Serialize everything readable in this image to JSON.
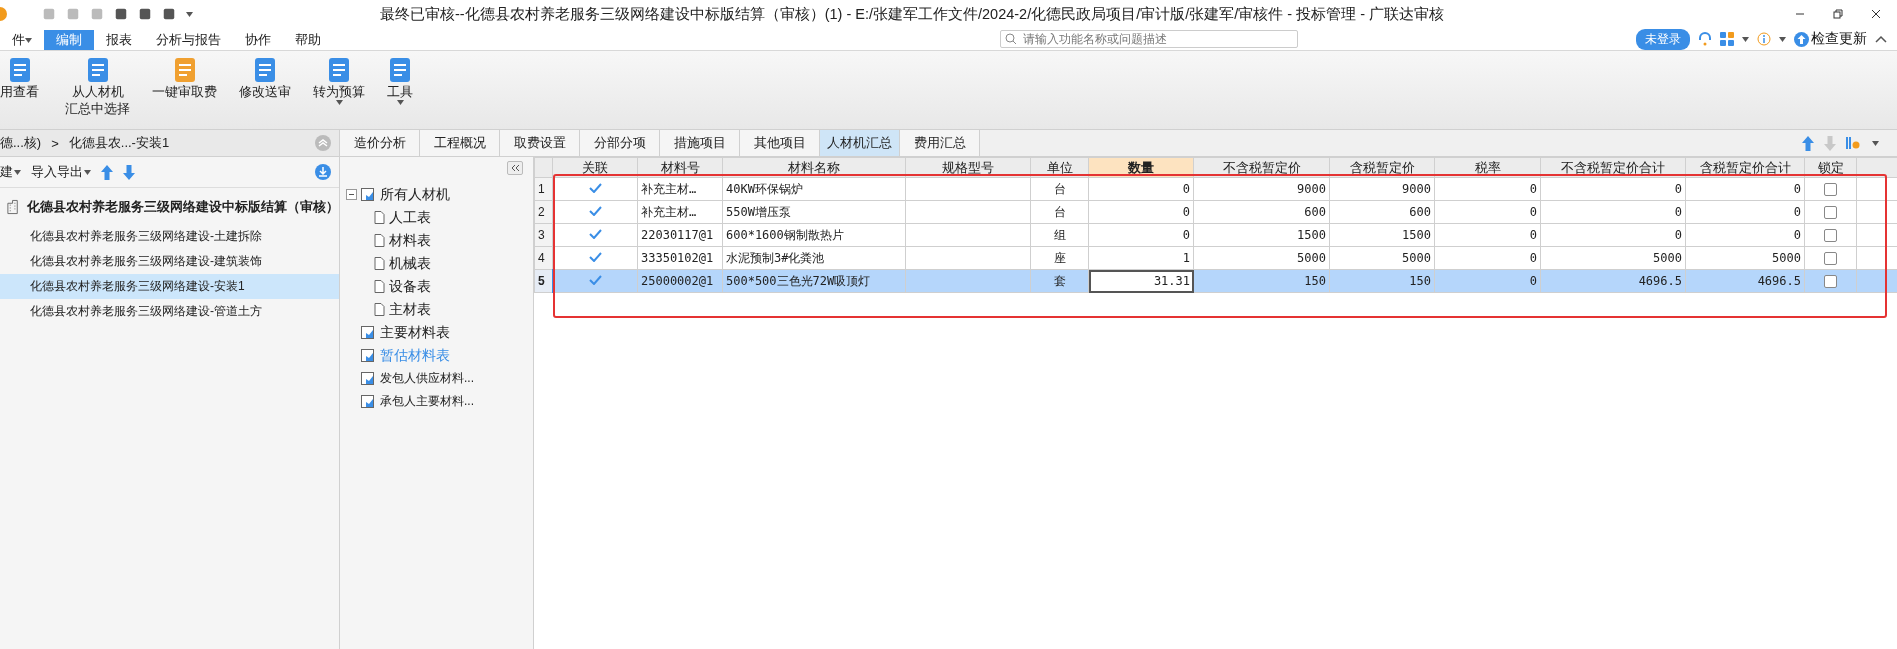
{
  "window": {
    "title": "最终已审核--化德县农村养老服务三级网络建设中标版结算（审核）(1) - E:/张建军工作文件/2024-2/化德民政局项目/审计版/张建军/审核件 - 投标管理 - 广联达审核"
  },
  "menu": [
    {
      "label": "件",
      "caret": true,
      "selected": false
    },
    {
      "label": "编制",
      "caret": false,
      "selected": true
    },
    {
      "label": "报表",
      "caret": false,
      "selected": false
    },
    {
      "label": "分析与报告",
      "caret": false,
      "selected": false
    },
    {
      "label": "协作",
      "caret": false,
      "selected": false
    },
    {
      "label": "帮助",
      "caret": false,
      "selected": false
    }
  ],
  "search": {
    "placeholder": "请输入功能名称或问题描述"
  },
  "login_badge": "未登录",
  "update_button": "检查更新",
  "ribbon": [
    {
      "label": [
        "用查看"
      ],
      "caret": false
    },
    {
      "label": [
        "从人材机",
        "汇总中选择"
      ],
      "caret": false
    },
    {
      "label": [
        "一键审取费"
      ],
      "caret": false
    },
    {
      "label": [
        "修改送审"
      ],
      "caret": false
    },
    {
      "label": [
        "转为预算"
      ],
      "caret": true
    },
    {
      "label": [
        "工具"
      ],
      "caret": true
    }
  ],
  "breadcrumb": [
    "德...核)",
    ">",
    "化德县农...-安装1"
  ],
  "left_toolbar": [
    "建",
    "导入导出"
  ],
  "project_tree": {
    "label": "化德县农村养老服务三级网络建设中标版结算（审核）",
    "children": [
      {
        "label": "化德县农村养老服务三级网络建设-土建拆除",
        "selected": false
      },
      {
        "label": "化德县农村养老服务三级网络建设-建筑装饰",
        "selected": false
      },
      {
        "label": "化德县农村养老服务三级网络建设-安装1",
        "selected": true
      },
      {
        "label": "化德县农村养老服务三级网络建设-管道土方",
        "selected": false
      }
    ]
  },
  "tabs": [
    {
      "label": "造价分析",
      "selected": false
    },
    {
      "label": "工程概况",
      "selected": false
    },
    {
      "label": "取费设置",
      "selected": false
    },
    {
      "label": "分部分项",
      "selected": false
    },
    {
      "label": "措施项目",
      "selected": false
    },
    {
      "label": "其他项目",
      "selected": false
    },
    {
      "label": "人材机汇总",
      "selected": true
    },
    {
      "label": "费用汇总",
      "selected": false
    }
  ],
  "material_tree": [
    {
      "label": "所有人材机",
      "selected": false,
      "expanded": true,
      "children": [
        {
          "label": "人工表",
          "selected": false
        },
        {
          "label": "材料表",
          "selected": false
        },
        {
          "label": "机械表",
          "selected": false
        },
        {
          "label": "设备表",
          "selected": false
        },
        {
          "label": "主材表",
          "selected": false
        }
      ]
    },
    {
      "label": "主要材料表",
      "selected": false
    },
    {
      "label": "暂估材料表",
      "selected": true
    },
    {
      "label": "发包人供应材料...",
      "selected": false
    },
    {
      "label": "承包人主要材料...",
      "selected": false
    }
  ],
  "table": {
    "columns": [
      "关联",
      "材料号",
      "材料名称",
      "规格型号",
      "单位",
      "数量",
      "不含税暂定价",
      "含税暂定价",
      "税率",
      "不含税暂定价合计",
      "含税暂定价合计",
      "锁定"
    ],
    "rows": [
      {
        "no": "1",
        "linked": true,
        "code": "补充主材…",
        "name": "40KW环保锅炉",
        "spec": "",
        "unit": "台",
        "qty": "0",
        "price": "9000",
        "price_tax": "9000",
        "rate": "0",
        "total": "0",
        "total_tax": "0",
        "locked": false,
        "selected": false
      },
      {
        "no": "2",
        "linked": true,
        "code": "补充主材…",
        "name": "550W增压泵",
        "spec": "",
        "unit": "台",
        "qty": "0",
        "price": "600",
        "price_tax": "600",
        "rate": "0",
        "total": "0",
        "total_tax": "0",
        "locked": false,
        "selected": false
      },
      {
        "no": "3",
        "linked": true,
        "code": "22030117@1",
        "name": "600*1600钢制散热片",
        "spec": "",
        "unit": "组",
        "qty": "0",
        "price": "1500",
        "price_tax": "1500",
        "rate": "0",
        "total": "0",
        "total_tax": "0",
        "locked": false,
        "selected": false
      },
      {
        "no": "4",
        "linked": true,
        "code": "33350102@1",
        "name": "水泥预制3#化粪池",
        "spec": "",
        "unit": "座",
        "qty": "1",
        "price": "5000",
        "price_tax": "5000",
        "rate": "0",
        "total": "5000",
        "total_tax": "5000",
        "locked": false,
        "selected": false
      },
      {
        "no": "5",
        "linked": true,
        "code": "25000002@1",
        "name": "500*500三色光72W吸顶灯",
        "spec": "",
        "unit": "套",
        "qty": "31.31",
        "price": "150",
        "price_tax": "150",
        "rate": "0",
        "total": "4696.5",
        "total_tax": "4696.5",
        "locked": false,
        "selected": true
      }
    ]
  }
}
